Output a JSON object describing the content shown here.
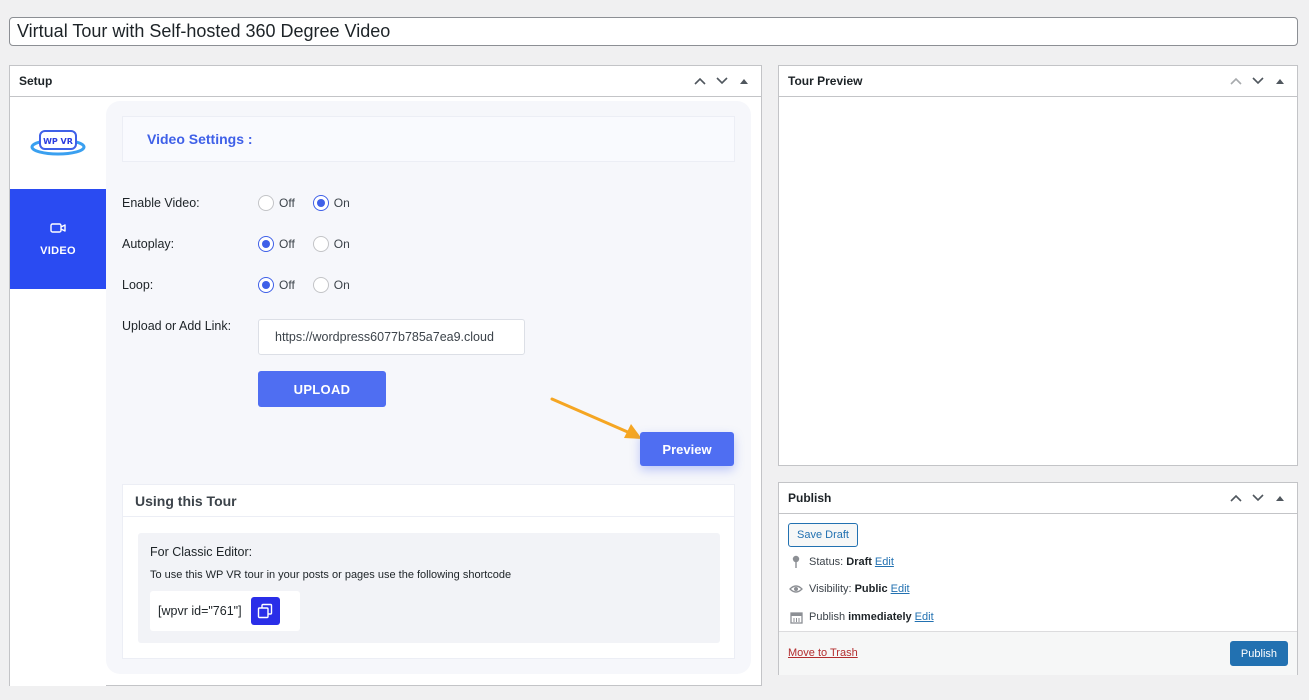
{
  "post_title": "Virtual Tour with Self-hosted 360 Degree Video",
  "setup": {
    "title": "Setup",
    "logo_text": "WP VR",
    "tab_video_label": "VIDEO",
    "section_title": "Video Settings :",
    "enable_video": {
      "label": "Enable Video:",
      "off": "Off",
      "on": "On",
      "selected": "On"
    },
    "autoplay": {
      "label": "Autoplay:",
      "off": "Off",
      "on": "On",
      "selected": "Off"
    },
    "loop": {
      "label": "Loop:",
      "off": "Off",
      "on": "On",
      "selected": "Off"
    },
    "upload_label": "Upload or Add Link:",
    "link_value": "https://wordpress6077b785a7ea9.cloud",
    "upload_button": "UPLOAD",
    "preview_button": "Preview",
    "using_title": "Using this Tour",
    "classic_title": "For Classic Editor:",
    "classic_desc": "To use this WP VR tour in your posts or pages use the following shortcode",
    "shortcode": "[wpvr id=\"761\"]"
  },
  "tour_preview": {
    "title": "Tour Preview"
  },
  "publish": {
    "title": "Publish",
    "save_draft": "Save Draft",
    "status_label": "Status:",
    "status_value": "Draft",
    "visibility_label": "Visibility:",
    "visibility_value": "Public",
    "publish_label": "Publish",
    "publish_value": "immediately",
    "edit": "Edit",
    "move_to_trash": "Move to Trash",
    "publish_button": "Publish"
  },
  "colors": {
    "accent": "#4f6ef2",
    "tab_active": "#2a4bf2",
    "wp_blue": "#2271b1",
    "trash_red": "#b32d2e",
    "arrow": "#f5a623"
  }
}
